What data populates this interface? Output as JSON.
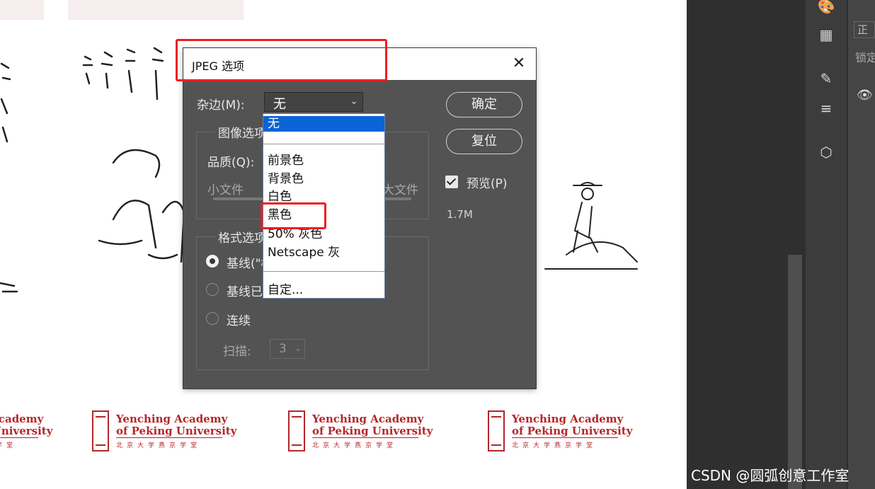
{
  "dialog": {
    "title": "JPEG 选项",
    "close_glyph": "✕",
    "matte_label": "杂边(M):",
    "matte_value": "无",
    "image_options_title": "图像选项",
    "quality_label": "品质(Q):",
    "small_file_label": "小文件",
    "large_file_label": "大文件",
    "format_options_title": "格式选项",
    "radio_baseline": "基线(\"标准\")",
    "radio_baseline_optimized": "基线已优化",
    "radio_progressive": "连续",
    "scan_label": "扫描:",
    "scan_value": "3",
    "ok_label": "确定",
    "reset_label": "复位",
    "preview_label": "预览(P)",
    "preview_checked": true,
    "file_size": "1.7M"
  },
  "matte_dropdown": {
    "items": [
      "无",
      "前景色",
      "背景色",
      "白色",
      "黑色",
      "50% 灰色",
      "Netscape 灰",
      "自定..."
    ],
    "selected": "无",
    "highlighted": "黑色"
  },
  "background": {
    "logo_line1": "Yenching Academy",
    "logo_line2": "of Peking University",
    "logo_subtitle": "北京大学燕京学堂"
  },
  "right_panel": {
    "tab_partial": "正",
    "lock_partial": "锁定",
    "icons": [
      "palette-icon",
      "grid-icon",
      "brush-settings-icon",
      "brush-presets-icon",
      "cube-icon",
      "eye-icon"
    ]
  },
  "watermark": "CSDN @圆弧创意工作室",
  "colors": {
    "highlight_red": "#ee1d23",
    "selection_blue": "#0a64d6",
    "dialog_bg": "#535353",
    "brand_red": "#b3262a"
  }
}
